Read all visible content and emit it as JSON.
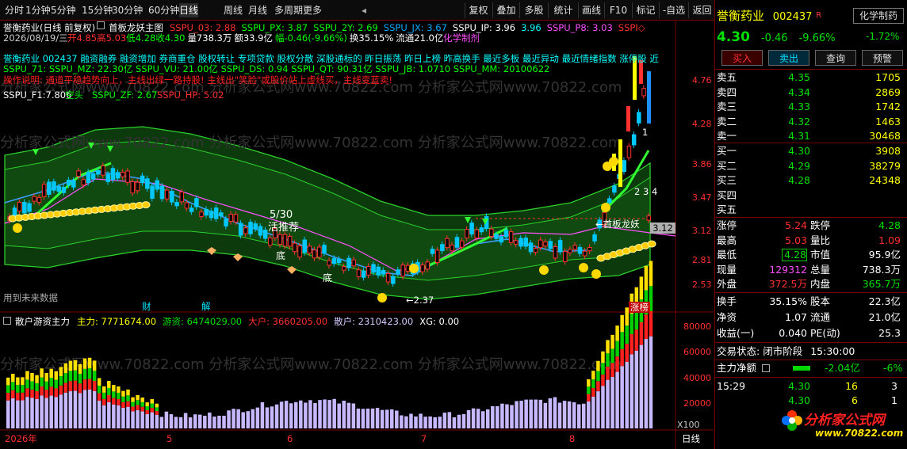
{
  "toolbar": {
    "left": [
      "分时",
      "1分钟",
      "5分钟",
      "15分钟",
      "30分钟",
      "60分钟",
      "日线",
      "周线",
      "月线",
      "多周期",
      "更多"
    ],
    "active": "日线",
    "right": [
      "复权",
      "叠加",
      "多股",
      "统计",
      "画线",
      "F10",
      "标记",
      "-自选",
      "返回"
    ]
  },
  "chart_header": {
    "title": "誉衡药业(日线 前复权)",
    "indicator": "首板龙妖主图",
    "sspu_items": [
      "SSPU_03: 2.88",
      "SSPU_PX: 3.87",
      "SSPU_2Y: 2.69",
      "SSPU_JX: 3.67",
      "SSPU_IP: 3.96",
      "3.96",
      "SSPU_P8: 3.03",
      "SSPI◇"
    ],
    "date_line": "2026/08/19/三",
    "ohlc": [
      "开4.85",
      "高5.03",
      "低4.28",
      "收4.30",
      "量738.3万",
      "额33.9亿",
      "幅-0.46(-9.66%)",
      "换35.15%",
      "流通21.0亿"
    ],
    "sector": "化学制剂",
    "concepts": "誉衡药业 002437 融资融券 融资增加 券商重仓 股权转让 专项贷款 股权分散 深股通标的 昨日振荡 昨日上榜 昨高换手 最近多板 最近异动 最近情绪指数 涨停股 近",
    "stats": "SSPU_71: SSPU_MZ: 22.30亿 SSPU_VU: 21.00亿 SSPU_DS: 0.94 SSPU_QT: 90.31亿 SSPU_JB: 1.0710 SSPU_MM: 20100622",
    "note": "操作说明: 通道平稳趋势向上，主线出绿一路持股! 主线出\"笑脸\"或股价站上虚线买，主线变蓝卖!",
    "f1": "SSPU_F1:7.806",
    "f1_tag": "空头",
    "zf": "SSPU_ZF: 2.67",
    "hp": "SSPU_HP: 5.02"
  },
  "price_axis": [
    "4.76",
    "4.28",
    "3.86",
    "3.47",
    "3.12",
    "2.81",
    "2.53"
  ],
  "chart_labels": {
    "date_530": "5/30",
    "recommend": "活推荐",
    "bottom1": "底",
    "bottom2": "底",
    "low_price": "←2.37",
    "first_board": "←首板龙妖",
    "marks_1": "1",
    "marks_234": "2 3 4",
    "future": "用到未来数据",
    "cai": "财",
    "jie": "解",
    "zhangbang": "涨榜",
    "price_tag": "3.12"
  },
  "volume_panel": {
    "title": "散户游资主力",
    "items": [
      {
        "k": "主力: 7771674.00",
        "c": "#ffff00"
      },
      {
        "k": "游资: 6474029.00",
        "c": "#00e000"
      },
      {
        "k": "大户: 3660205.00",
        "c": "#ff3030"
      },
      {
        "k": "散户: 2310423.00",
        "c": "#d8c8ff"
      },
      {
        "k": "XG: 0.00",
        "c": "#ffffff"
      }
    ],
    "axis": [
      "80000",
      "60000",
      "40000",
      "20000"
    ],
    "unit": "X100"
  },
  "x_axis": {
    "labels": [
      "2026年",
      "5",
      "6",
      "7",
      "8"
    ],
    "period": "日线"
  },
  "stock": {
    "name": "誉衡药业",
    "code": "002437",
    "r": "R",
    "sector": "化学制药",
    "price": "4.30",
    "change": "-0.46",
    "pct": "-9.66%",
    "sector_pct": "-1.72%"
  },
  "trade_buttons": [
    "买入",
    "卖出",
    "查询",
    "预警"
  ],
  "order_book": {
    "sell": [
      {
        "l": "卖五",
        "p": "4.35",
        "v": "1705"
      },
      {
        "l": "卖四",
        "p": "4.34",
        "v": "2869"
      },
      {
        "l": "卖三",
        "p": "4.33",
        "v": "1742"
      },
      {
        "l": "卖二",
        "p": "4.32",
        "v": "1463"
      },
      {
        "l": "卖一",
        "p": "4.31",
        "v": "30468"
      }
    ],
    "buy": [
      {
        "l": "买一",
        "p": "4.30",
        "v": "3908"
      },
      {
        "l": "买二",
        "p": "4.29",
        "v": "38279"
      },
      {
        "l": "买三",
        "p": "4.28",
        "v": "24348"
      },
      {
        "l": "买四",
        "p": "",
        "v": ""
      },
      {
        "l": "买五",
        "p": "",
        "v": ""
      }
    ]
  },
  "quote": [
    [
      "涨停",
      "5.24",
      "跌停",
      "4.28"
    ],
    [
      "最高",
      "5.03",
      "量比",
      "1.09"
    ],
    [
      "最低",
      "4.28",
      "市值",
      "95.9亿"
    ],
    [
      "现量",
      "129312",
      "总量",
      "738.3万"
    ],
    [
      "外盘",
      "372.5万",
      "内盘",
      "365.7万"
    ]
  ],
  "quote2": [
    [
      "换手",
      "35.15%",
      "股本",
      "22.3亿"
    ],
    [
      "净资",
      "1.07",
      "流通",
      "21.0亿"
    ],
    [
      "收益(一)",
      "0.040",
      "PE(动)",
      "25.3"
    ]
  ],
  "trade_status": {
    "label": "交易状态:",
    "status": "闭市阶段",
    "time": "15:30:00"
  },
  "net_flow": {
    "label": "主力净额",
    "value": "-2.04亿",
    "pct": "-6%"
  },
  "ticks": [
    {
      "t": "15:29",
      "p": "4.30",
      "v": "16",
      "f": "3"
    },
    {
      "t": "",
      "p": "4.30",
      "v": "6",
      "f": "1"
    }
  ],
  "logo": {
    "text": "分析家公式网",
    "url": "www.70822.com"
  },
  "watermark": "分析家公式网www.70822.com"
}
